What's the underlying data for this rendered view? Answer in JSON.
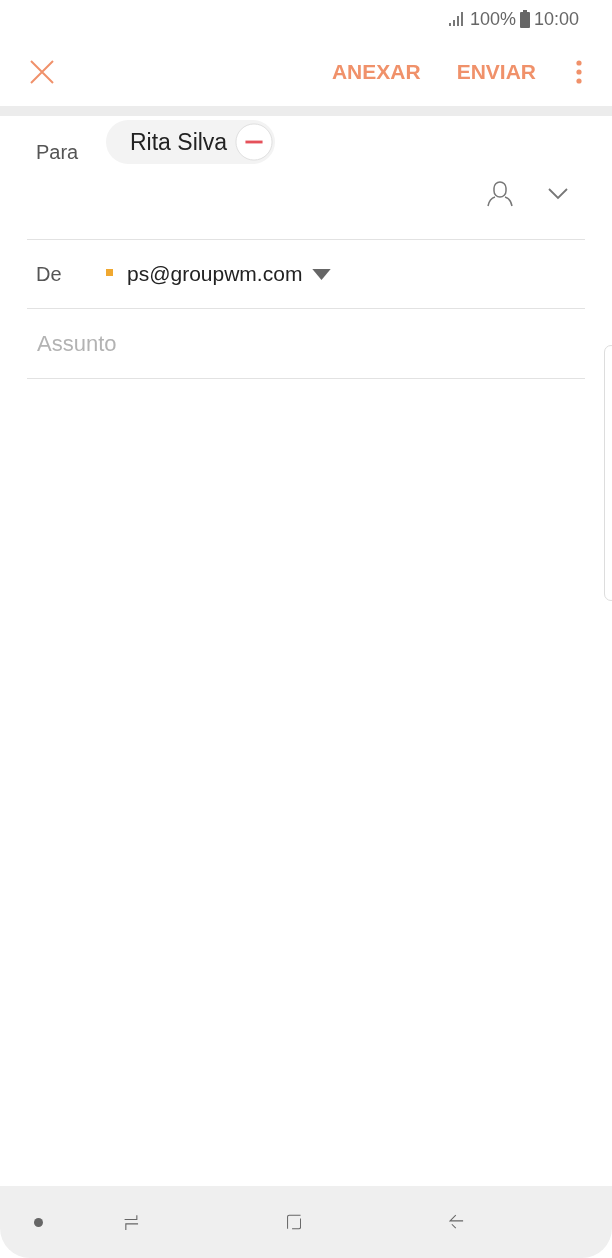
{
  "status_bar": {
    "battery": "100%",
    "time": "10:00"
  },
  "toolbar": {
    "actions": [
      "ANEXAR",
      "ENVIAR"
    ]
  },
  "to": {
    "label": "Para",
    "recipients": [
      {
        "name": "Rita Silva"
      }
    ]
  },
  "from": {
    "label": "De",
    "account": "ps@groupwm.com"
  },
  "subject": {
    "placeholder": "Assunto"
  }
}
